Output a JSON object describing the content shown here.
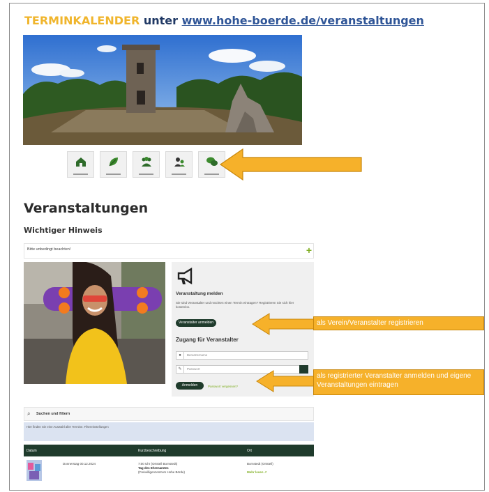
{
  "header": {
    "part1": "TERMINKALENDER",
    "part2": "unter",
    "url": "www.hohe-boerde.de/veranstaltungen"
  },
  "icons": [
    "home-icon",
    "leaf-icon",
    "people-icon",
    "user-group-icon",
    "speech-bubbles-icon"
  ],
  "page": {
    "title": "Veranstaltungen",
    "subtitle": "Wichtiger Hinweis",
    "notice_label": "Bitte unbedingt beachten!",
    "notice_toggle": "+"
  },
  "panel": {
    "heading": "Veranstaltung melden",
    "text": "Sie sind Veranstalter und möchten einen Termin eintragen? Registrieren Sie sich hier kostenlos.",
    "register_btn": "Veranstalter anmelden",
    "login_heading": "Zugang für Veranstalter",
    "user_placeholder": "Benutzername",
    "pass_placeholder": "Passwort",
    "login_btn": "Anmelden",
    "forgot": "Passwort vergessen?"
  },
  "callouts": {
    "register": "als Verein/Veranstalter registrieren",
    "login": "als registrierter Veranstalter anmelden und eigene Veranstaltungen eintragen"
  },
  "search": {
    "icon": "search-icon",
    "label": "Suchen und filtern",
    "info": "Hier finden Sie eine Auswahl aller Termine. Filtereinstellungen"
  },
  "table": {
    "headers": [
      "Datum",
      "Kurzbeschreibung",
      "Ort"
    ],
    "rows": [
      {
        "date": "Donnerstag 00.12.2024",
        "desc1": "7:00 Uhr (Ortsteil Bornstedt)",
        "desc2": "Tag des Ehrenamtes",
        "desc3": "(Freiwilligenzentrum Hohe Börde)",
        "place": "Bornstedt (Ortsteil)",
        "more": "Mehr lesen ↗"
      }
    ]
  },
  "colors": {
    "accent_orange": "#f6b12a",
    "dark_green": "#1f3b2c",
    "link_blue": "#2f5597",
    "lime": "#7fae22"
  }
}
